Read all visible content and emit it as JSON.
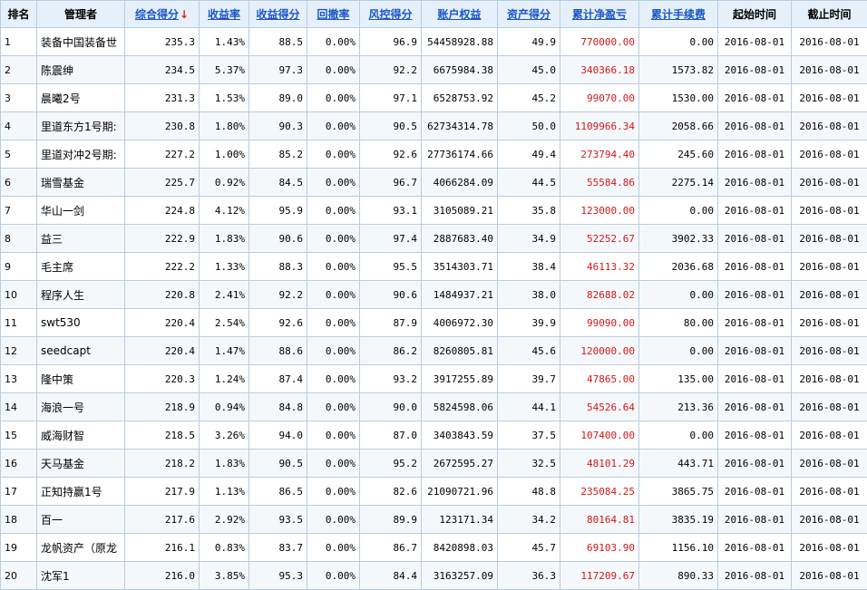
{
  "headers": {
    "rank": "排名",
    "manager": "管理者",
    "composite": "综合得分",
    "composite_arrow": "↓",
    "return_rate": "收益率",
    "return_score": "收益得分",
    "drawdown": "回撤率",
    "risk_score": "风控得分",
    "equity": "账户权益",
    "asset_score": "资产得分",
    "net_pnl": "累计净盈亏",
    "fees": "累计手续费",
    "start": "起始时间",
    "end": "截止时间"
  },
  "colors": {
    "header_bg": "#e6f0fa",
    "link": "#1a55c6",
    "profit": "#d01818",
    "border": "#b7cde0"
  },
  "rows": [
    {
      "rank": "1",
      "manager": "装备中国装备世",
      "composite": "235.3",
      "return_rate": "1.43%",
      "return_score": "88.5",
      "drawdown": "0.00%",
      "risk_score": "96.9",
      "equity": "54458928.88",
      "asset_score": "49.9",
      "net_pnl": "770000.00",
      "fees": "0.00",
      "start": "2016-08-01",
      "end": "2016-08-01"
    },
    {
      "rank": "2",
      "manager": "陈震绅",
      "composite": "234.5",
      "return_rate": "5.37%",
      "return_score": "97.3",
      "drawdown": "0.00%",
      "risk_score": "92.2",
      "equity": "6675984.38",
      "asset_score": "45.0",
      "net_pnl": "340366.18",
      "fees": "1573.82",
      "start": "2016-08-01",
      "end": "2016-08-01"
    },
    {
      "rank": "3",
      "manager": "晨曦2号",
      "composite": "231.3",
      "return_rate": "1.53%",
      "return_score": "89.0",
      "drawdown": "0.00%",
      "risk_score": "97.1",
      "equity": "6528753.92",
      "asset_score": "45.2",
      "net_pnl": "99070.00",
      "fees": "1530.00",
      "start": "2016-08-01",
      "end": "2016-08-01"
    },
    {
      "rank": "4",
      "manager": "里道东方1号期:",
      "composite": "230.8",
      "return_rate": "1.80%",
      "return_score": "90.3",
      "drawdown": "0.00%",
      "risk_score": "90.5",
      "equity": "62734314.78",
      "asset_score": "50.0",
      "net_pnl": "1109966.34",
      "fees": "2058.66",
      "start": "2016-08-01",
      "end": "2016-08-01"
    },
    {
      "rank": "5",
      "manager": "里道对冲2号期:",
      "composite": "227.2",
      "return_rate": "1.00%",
      "return_score": "85.2",
      "drawdown": "0.00%",
      "risk_score": "92.6",
      "equity": "27736174.66",
      "asset_score": "49.4",
      "net_pnl": "273794.40",
      "fees": "245.60",
      "start": "2016-08-01",
      "end": "2016-08-01"
    },
    {
      "rank": "6",
      "manager": "瑞雪基金",
      "composite": "225.7",
      "return_rate": "0.92%",
      "return_score": "84.5",
      "drawdown": "0.00%",
      "risk_score": "96.7",
      "equity": "4066284.09",
      "asset_score": "44.5",
      "net_pnl": "55584.86",
      "fees": "2275.14",
      "start": "2016-08-01",
      "end": "2016-08-01"
    },
    {
      "rank": "7",
      "manager": "华山一剑",
      "composite": "224.8",
      "return_rate": "4.12%",
      "return_score": "95.9",
      "drawdown": "0.00%",
      "risk_score": "93.1",
      "equity": "3105089.21",
      "asset_score": "35.8",
      "net_pnl": "123000.00",
      "fees": "0.00",
      "start": "2016-08-01",
      "end": "2016-08-01"
    },
    {
      "rank": "8",
      "manager": "益三",
      "composite": "222.9",
      "return_rate": "1.83%",
      "return_score": "90.6",
      "drawdown": "0.00%",
      "risk_score": "97.4",
      "equity": "2887683.40",
      "asset_score": "34.9",
      "net_pnl": "52252.67",
      "fees": "3902.33",
      "start": "2016-08-01",
      "end": "2016-08-01"
    },
    {
      "rank": "9",
      "manager": "毛主席",
      "composite": "222.2",
      "return_rate": "1.33%",
      "return_score": "88.3",
      "drawdown": "0.00%",
      "risk_score": "95.5",
      "equity": "3514303.71",
      "asset_score": "38.4",
      "net_pnl": "46113.32",
      "fees": "2036.68",
      "start": "2016-08-01",
      "end": "2016-08-01"
    },
    {
      "rank": "10",
      "manager": "程序人生",
      "composite": "220.8",
      "return_rate": "2.41%",
      "return_score": "92.2",
      "drawdown": "0.00%",
      "risk_score": "90.6",
      "equity": "1484937.21",
      "asset_score": "38.0",
      "net_pnl": "82688.02",
      "fees": "0.00",
      "start": "2016-08-01",
      "end": "2016-08-01"
    },
    {
      "rank": "11",
      "manager": "swt530",
      "composite": "220.4",
      "return_rate": "2.54%",
      "return_score": "92.6",
      "drawdown": "0.00%",
      "risk_score": "87.9",
      "equity": "4006972.30",
      "asset_score": "39.9",
      "net_pnl": "99090.00",
      "fees": "80.00",
      "start": "2016-08-01",
      "end": "2016-08-01"
    },
    {
      "rank": "12",
      "manager": "seedcapt",
      "composite": "220.4",
      "return_rate": "1.47%",
      "return_score": "88.6",
      "drawdown": "0.00%",
      "risk_score": "86.2",
      "equity": "8260805.81",
      "asset_score": "45.6",
      "net_pnl": "120000.00",
      "fees": "0.00",
      "start": "2016-08-01",
      "end": "2016-08-01"
    },
    {
      "rank": "13",
      "manager": "隆中策",
      "composite": "220.3",
      "return_rate": "1.24%",
      "return_score": "87.4",
      "drawdown": "0.00%",
      "risk_score": "93.2",
      "equity": "3917255.89",
      "asset_score": "39.7",
      "net_pnl": "47865.00",
      "fees": "135.00",
      "start": "2016-08-01",
      "end": "2016-08-01"
    },
    {
      "rank": "14",
      "manager": "海浪一号",
      "composite": "218.9",
      "return_rate": "0.94%",
      "return_score": "84.8",
      "drawdown": "0.00%",
      "risk_score": "90.0",
      "equity": "5824598.06",
      "asset_score": "44.1",
      "net_pnl": "54526.64",
      "fees": "213.36",
      "start": "2016-08-01",
      "end": "2016-08-01"
    },
    {
      "rank": "15",
      "manager": "威海财智",
      "composite": "218.5",
      "return_rate": "3.26%",
      "return_score": "94.0",
      "drawdown": "0.00%",
      "risk_score": "87.0",
      "equity": "3403843.59",
      "asset_score": "37.5",
      "net_pnl": "107400.00",
      "fees": "0.00",
      "start": "2016-08-01",
      "end": "2016-08-01"
    },
    {
      "rank": "16",
      "manager": "天马基金",
      "composite": "218.2",
      "return_rate": "1.83%",
      "return_score": "90.5",
      "drawdown": "0.00%",
      "risk_score": "95.2",
      "equity": "2672595.27",
      "asset_score": "32.5",
      "net_pnl": "48101.29",
      "fees": "443.71",
      "start": "2016-08-01",
      "end": "2016-08-01"
    },
    {
      "rank": "17",
      "manager": "正知持赢1号",
      "composite": "217.9",
      "return_rate": "1.13%",
      "return_score": "86.5",
      "drawdown": "0.00%",
      "risk_score": "82.6",
      "equity": "21090721.96",
      "asset_score": "48.8",
      "net_pnl": "235084.25",
      "fees": "3865.75",
      "start": "2016-08-01",
      "end": "2016-08-01"
    },
    {
      "rank": "18",
      "manager": "百一",
      "composite": "217.6",
      "return_rate": "2.92%",
      "return_score": "93.5",
      "drawdown": "0.00%",
      "risk_score": "89.9",
      "equity": "123171.34",
      "asset_score": "34.2",
      "net_pnl": "80164.81",
      "fees": "3835.19",
      "start": "2016-08-01",
      "end": "2016-08-01"
    },
    {
      "rank": "19",
      "manager": "龙帆资产（原龙",
      "composite": "216.1",
      "return_rate": "0.83%",
      "return_score": "83.7",
      "drawdown": "0.00%",
      "risk_score": "86.7",
      "equity": "8420898.03",
      "asset_score": "45.7",
      "net_pnl": "69103.90",
      "fees": "1156.10",
      "start": "2016-08-01",
      "end": "2016-08-01"
    },
    {
      "rank": "20",
      "manager": "沈军1",
      "composite": "216.0",
      "return_rate": "3.85%",
      "return_score": "95.3",
      "drawdown": "0.00%",
      "risk_score": "84.4",
      "equity": "3163257.09",
      "asset_score": "36.3",
      "net_pnl": "117209.67",
      "fees": "890.33",
      "start": "2016-08-01",
      "end": "2016-08-01"
    }
  ]
}
